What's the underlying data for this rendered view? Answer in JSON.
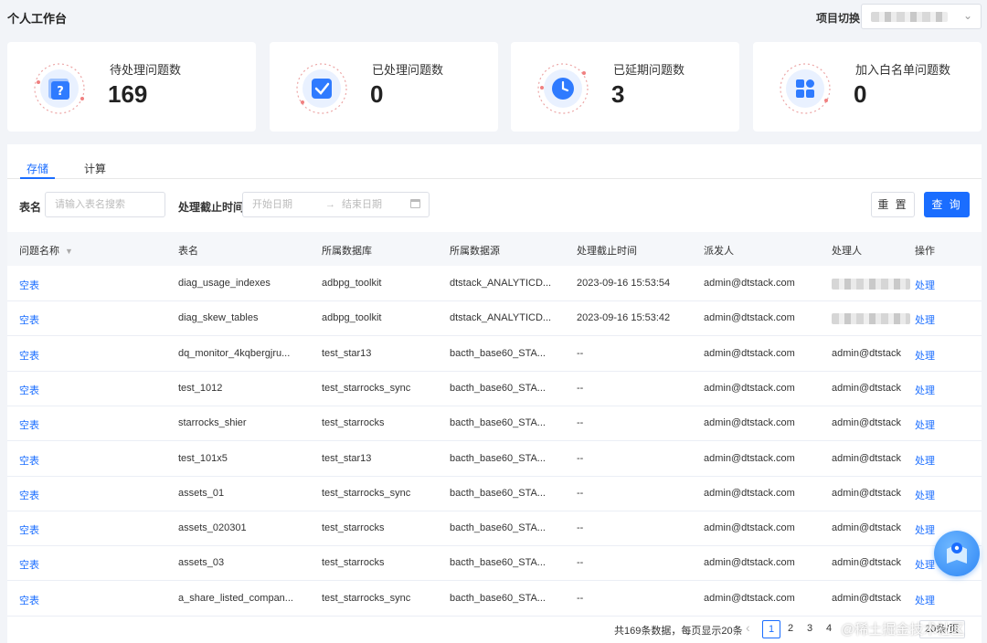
{
  "page": {
    "title": "个人工作台",
    "project_label": "项目切换"
  },
  "cards": [
    {
      "label": "待处理问题数",
      "value": "169",
      "icon": "question-icon"
    },
    {
      "label": "已处理问题数",
      "value": "0",
      "icon": "check-icon"
    },
    {
      "label": "已延期问题数",
      "value": "3",
      "icon": "clock-icon"
    },
    {
      "label": "加入白名单问题数",
      "value": "0",
      "icon": "grid-icon"
    }
  ],
  "tabs": [
    {
      "label": "存储",
      "active": true
    },
    {
      "label": "计算",
      "active": false
    }
  ],
  "filters": {
    "table_label": "表名",
    "table_placeholder": "请输入表名搜索",
    "deadline_label": "处理截止时间",
    "start_placeholder": "开始日期",
    "end_placeholder": "结束日期",
    "reset_label": "重 置",
    "query_label": "查 询"
  },
  "table": {
    "columns": [
      "问题名称",
      "表名",
      "所属数据库",
      "所属数据源",
      "处理截止时间",
      "派发人",
      "处理人",
      "操作"
    ],
    "rows": [
      [
        "空表",
        "diag_usage_indexes",
        "adbpg_toolkit",
        "dtstack_ANALYTICD...",
        "2023-09-16 15:53:54",
        "admin@dtstack.com",
        "",
        "处理"
      ],
      [
        "空表",
        "diag_skew_tables",
        "adbpg_toolkit",
        "dtstack_ANALYTICD...",
        "2023-09-16 15:53:42",
        "admin@dtstack.com",
        "",
        "处理"
      ],
      [
        "空表",
        "dq_monitor_4kqbergjru...",
        "test_star13",
        "bacth_base60_STA...",
        "--",
        "admin@dtstack.com",
        "admin@dtstack",
        "处理"
      ],
      [
        "空表",
        "test_1012",
        "test_starrocks_sync",
        "bacth_base60_STA...",
        "--",
        "admin@dtstack.com",
        "admin@dtstack",
        "处理"
      ],
      [
        "空表",
        "starrocks_shier",
        "test_starrocks",
        "bacth_base60_STA...",
        "--",
        "admin@dtstack.com",
        "admin@dtstack",
        "处理"
      ],
      [
        "空表",
        "test_101x5",
        "test_star13",
        "bacth_base60_STA...",
        "--",
        "admin@dtstack.com",
        "admin@dtstack",
        "处理"
      ],
      [
        "空表",
        "assets_01",
        "test_starrocks_sync",
        "bacth_base60_STA...",
        "--",
        "admin@dtstack.com",
        "admin@dtstack",
        "处理"
      ],
      [
        "空表",
        "assets_020301",
        "test_starrocks",
        "bacth_base60_STA...",
        "--",
        "admin@dtstack.com",
        "admin@dtstack",
        "处理"
      ],
      [
        "空表",
        "assets_03",
        "test_starrocks",
        "bacth_base60_STA...",
        "--",
        "admin@dtstack.com",
        "admin@dtstack",
        "处理"
      ],
      [
        "空表",
        "a_share_listed_compan...",
        "test_starrocks_sync",
        "bacth_base60_STA...",
        "--",
        "admin@dtstack.com",
        "admin@dtstack",
        "处理"
      ]
    ]
  },
  "pagination": {
    "summary": "共169条数据，每页显示20条",
    "pages": [
      "1",
      "2",
      "3",
      "4"
    ],
    "current": "1",
    "page_size": "20条/页"
  },
  "watermark": "@稀土掘金技术社区",
  "colors": {
    "primary": "#1a6dff",
    "background": "#f2f4f8"
  }
}
